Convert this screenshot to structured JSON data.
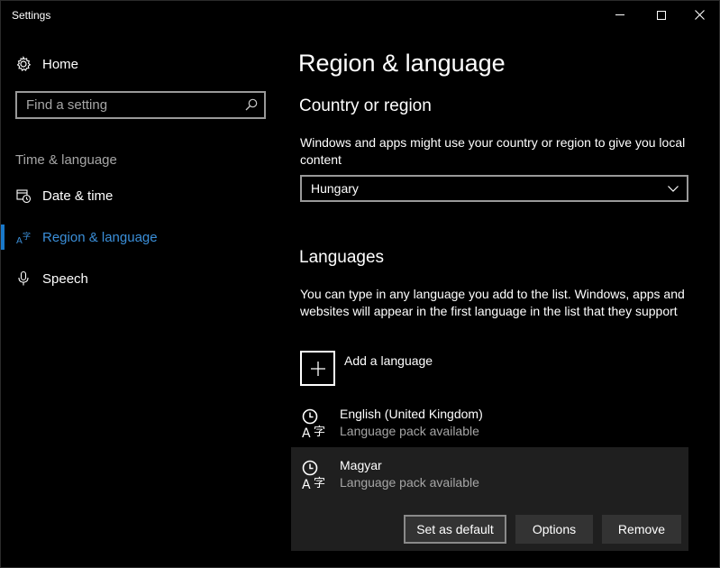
{
  "window": {
    "title": "Settings"
  },
  "sidebar": {
    "home_label": "Home",
    "search_placeholder": "Find a setting",
    "section_label": "Time & language",
    "items": [
      {
        "label": "Date & time",
        "icon": "calendar-clock-icon"
      },
      {
        "label": "Region & language",
        "icon": "region-language-icon",
        "active": true
      },
      {
        "label": "Speech",
        "icon": "microphone-icon"
      }
    ]
  },
  "main": {
    "title": "Region & language",
    "country_heading": "Country or region",
    "country_desc": "Windows and apps might use your country or region to give you local content",
    "country_value": "Hungary",
    "languages_heading": "Languages",
    "languages_desc": "You can type in any language you add to the list. Windows, apps and websites will appear in the first language in the list that they support",
    "add_language_label": "Add a language",
    "languages": [
      {
        "name": "English (United Kingdom)",
        "status": "Language pack available"
      },
      {
        "name": "Magyar",
        "status": "Language pack available",
        "selected": true
      }
    ],
    "buttons": {
      "set_default": "Set as default",
      "options": "Options",
      "remove": "Remove"
    }
  },
  "colors": {
    "accent": "#1979ca",
    "background": "#000000",
    "selected_row": "#1f1f1f",
    "button": "#333333"
  }
}
